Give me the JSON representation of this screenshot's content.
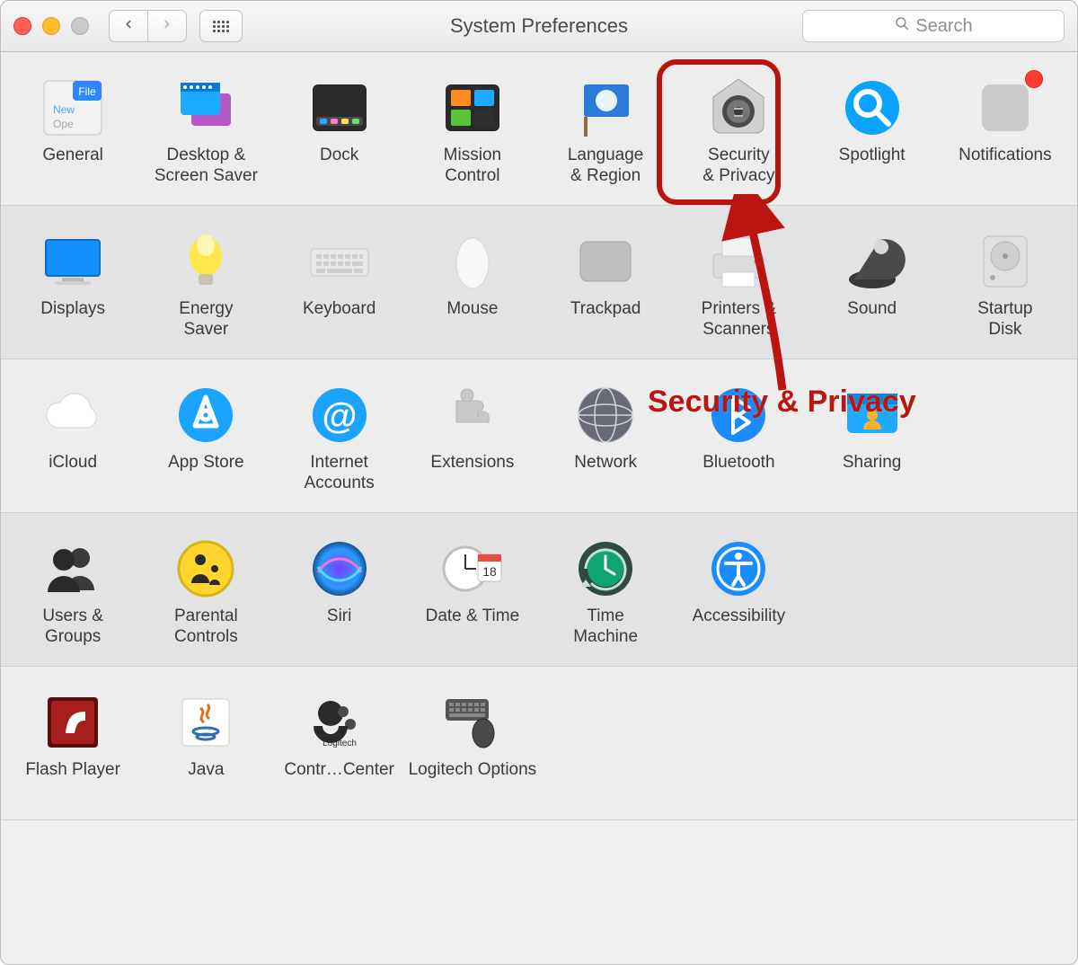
{
  "window": {
    "title": "System Preferences"
  },
  "search": {
    "placeholder": "Search"
  },
  "annotation": {
    "label": "Security & Privacy"
  },
  "rows": {
    "r0": {
      "general": "General",
      "desktop": "Desktop &\nScreen Saver",
      "dock": "Dock",
      "mission_control": "Mission\nControl",
      "language_region": "Language\n& Region",
      "security_privacy": "Security\n& Privacy",
      "spotlight": "Spotlight",
      "notifications": "Notifications"
    },
    "r1": {
      "displays": "Displays",
      "energy_saver": "Energy\nSaver",
      "keyboard": "Keyboard",
      "mouse": "Mouse",
      "trackpad": "Trackpad",
      "printers_scanners": "Printers &\nScanners",
      "sound": "Sound",
      "startup_disk": "Startup\nDisk"
    },
    "r2": {
      "icloud": "iCloud",
      "app_store": "App Store",
      "internet_accounts": "Internet\nAccounts",
      "extensions": "Extensions",
      "network": "Network",
      "bluetooth": "Bluetooth",
      "sharing": "Sharing"
    },
    "r3": {
      "users_groups": "Users &\nGroups",
      "parental_controls": "Parental\nControls",
      "siri": "Siri",
      "date_time": "Date & Time",
      "time_machine": "Time\nMachine",
      "accessibility": "Accessibility"
    },
    "r4": {
      "flash_player": "Flash Player",
      "java": "Java",
      "logitech_control": "Contr…Center",
      "logitech_options": "Logitech Options"
    }
  }
}
